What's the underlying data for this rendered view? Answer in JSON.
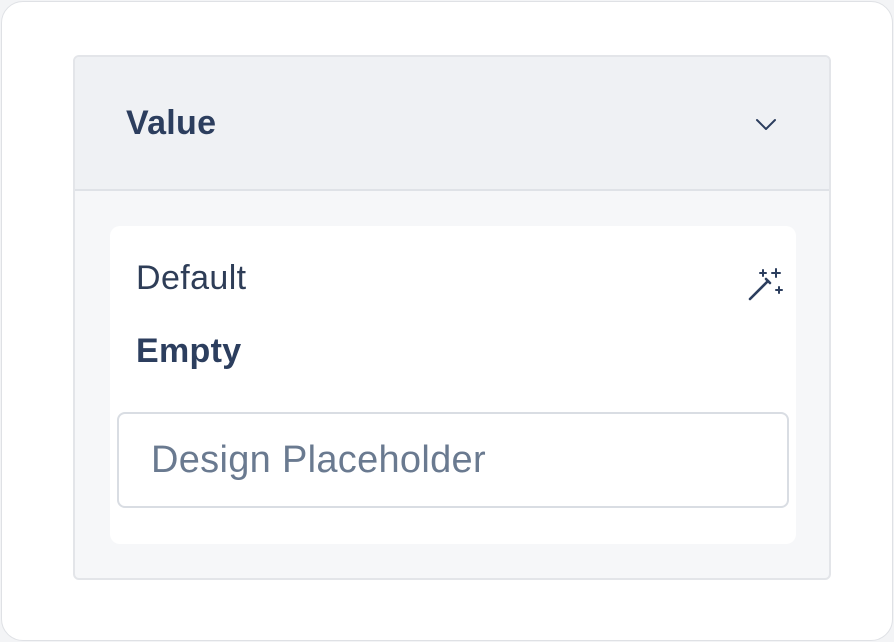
{
  "panel": {
    "title": "Value",
    "toggle_icon": "chevron-down-icon"
  },
  "field": {
    "label": "Default",
    "action_icon": "magic-wand-icon",
    "value_label": "Empty",
    "input": {
      "value": "",
      "placeholder": "Design Placeholder"
    }
  },
  "colors": {
    "text_primary": "#2c3e5e",
    "placeholder": "#6a7a90",
    "header_bg": "#eff1f4",
    "panel_bg": "#f6f7f9",
    "card_bg": "#ffffff",
    "border": "#d9dde3"
  }
}
